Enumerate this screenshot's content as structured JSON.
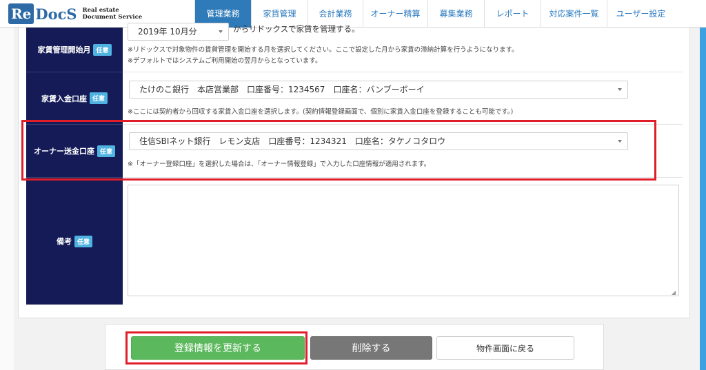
{
  "logo": {
    "re": "Re",
    "docs": "DocS",
    "tagline1": "Real estate",
    "tagline2": "Document Service"
  },
  "nav": [
    {
      "label": "管理業務",
      "active": true
    },
    {
      "label": "家賃管理"
    },
    {
      "label": "会計業務"
    },
    {
      "label": "オーナー精算"
    },
    {
      "label": "募集業務"
    },
    {
      "label": "レポート"
    },
    {
      "label": "対応案件一覧"
    },
    {
      "label": "ユーザー設定"
    }
  ],
  "form": {
    "badge": "任意",
    "start_month": {
      "label": "家賃管理開始月",
      "select_value": "2019年 10月分",
      "select_suffix": "からリドックスで家賃を管理する。",
      "note1": "※リドックスで対象物件の賃貸管理を開始する月を選択してください。ここで設定した月から家賃の滞納計算を行うようになります。",
      "note2": "※デフォルトではシステムご利用開始の翌月からとなっています。"
    },
    "rent_account": {
      "label": "家賃入金口座",
      "select_value": "たけのこ銀行　本店営業部　口座番号：1234567　口座名：バンブーボーイ",
      "note": "※ここには契約者から回収する家賃入金口座を選択します。(契約情報登録画面で、個別に家賃入金口座を登録することも可能です。)"
    },
    "owner_account": {
      "label": "オーナー送金口座",
      "select_value": "住信SBIネット銀行　レモン支店　口座番号：1234321　口座名：タケノコタロウ",
      "note": "※「オーナー登録口座」を選択した場合は、「オーナー情報登録」で入力した口座情報が適用されます。"
    },
    "remarks": {
      "label": "備考",
      "value": ""
    }
  },
  "buttons": {
    "update": "登録情報を更新する",
    "delete": "削除する",
    "back": "物件画面に戻る"
  },
  "colors": {
    "navy": "#141b57",
    "accent": "#2f7ab9",
    "highlight": "#e11d2a",
    "green": "#5cb85c"
  }
}
